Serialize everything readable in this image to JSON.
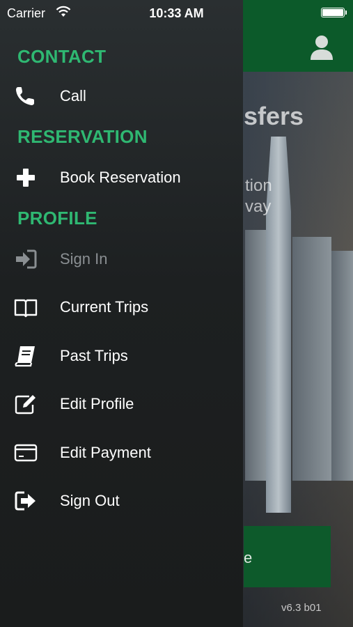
{
  "status_bar": {
    "carrier": "Carrier",
    "time": "10:33 AM"
  },
  "background": {
    "title_fragment": "sfers",
    "subtitle_fragment": "tion\nvay",
    "button_fragment": "e",
    "version": "v6.3  b01",
    "header_color": "#0c5a2a"
  },
  "drawer": {
    "accent_color": "#2fb872",
    "sections": {
      "contact": "CONTACT",
      "reservation": "RESERVATION",
      "profile": "PROFILE"
    },
    "items": {
      "call": {
        "label": "Call",
        "icon": "phone-icon"
      },
      "book": {
        "label": "Book Reservation",
        "icon": "plus-icon"
      },
      "sign_in": {
        "label": "Sign In",
        "icon": "sign-in-icon",
        "disabled": true
      },
      "current_trips": {
        "label": "Current Trips",
        "icon": "open-book-icon"
      },
      "past_trips": {
        "label": "Past Trips",
        "icon": "closed-book-icon"
      },
      "edit_profile": {
        "label": "Edit Profile",
        "icon": "edit-icon"
      },
      "edit_payment": {
        "label": "Edit Payment",
        "icon": "credit-card-icon"
      },
      "sign_out": {
        "label": "Sign Out",
        "icon": "sign-out-icon"
      }
    }
  }
}
